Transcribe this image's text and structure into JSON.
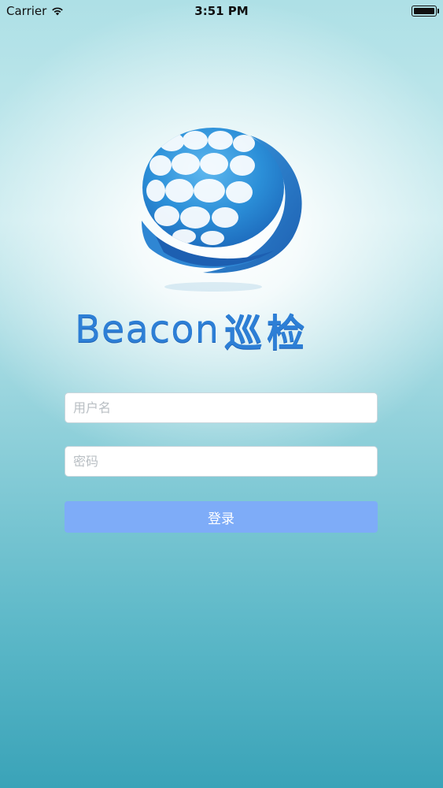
{
  "status_bar": {
    "carrier": "Carrier",
    "time": "3:51 PM",
    "icons": [
      "wifi-icon",
      "battery-icon"
    ]
  },
  "logo": {
    "text_en": "Beacon",
    "text_cn": "巡检",
    "icon": "globe-logo-icon",
    "color": "#2d7fd6"
  },
  "form": {
    "username_placeholder": "用户名",
    "username_value": "",
    "password_placeholder": "密码",
    "password_value": "",
    "login_label": "登录"
  },
  "colors": {
    "button": "#7eacf8",
    "background_top": "#aee0e6",
    "background_bottom": "#3aa3b8"
  }
}
